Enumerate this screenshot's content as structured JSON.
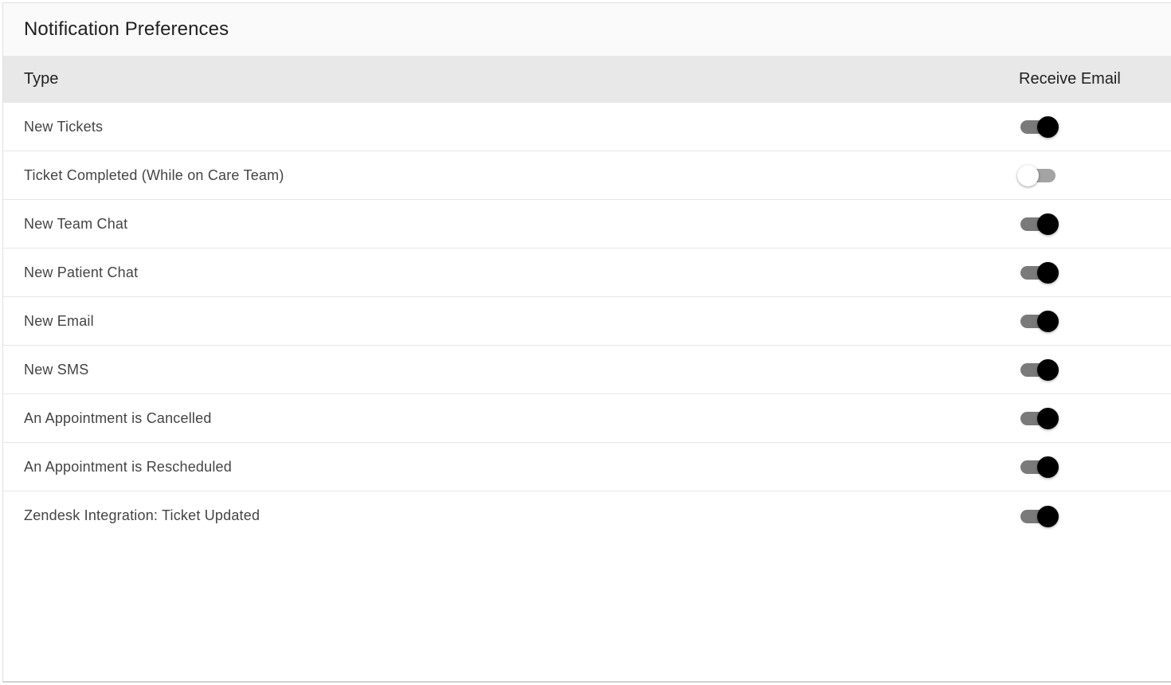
{
  "header": {
    "title": "Notification Preferences"
  },
  "table": {
    "columns": {
      "type": "Type",
      "receive_email": "Receive Email"
    },
    "rows": [
      {
        "label": "New Tickets",
        "receive_email": true
      },
      {
        "label": "Ticket Completed (While on Care Team)",
        "receive_email": false
      },
      {
        "label": "New Team Chat",
        "receive_email": true
      },
      {
        "label": "New Patient Chat",
        "receive_email": true
      },
      {
        "label": "New Email",
        "receive_email": true
      },
      {
        "label": "New SMS",
        "receive_email": true
      },
      {
        "label": "An Appointment is Cancelled",
        "receive_email": true
      },
      {
        "label": "An Appointment is Rescheduled",
        "receive_email": true
      },
      {
        "label": "Zendesk Integration: Ticket Updated",
        "receive_email": true
      }
    ]
  },
  "colors": {
    "toggle_on_thumb": "#000000",
    "toggle_on_track": "#7a7a7a",
    "toggle_off_thumb": "#ffffff",
    "toggle_off_track": "#a3a3a3",
    "header_bg": "#e8e8e8"
  }
}
